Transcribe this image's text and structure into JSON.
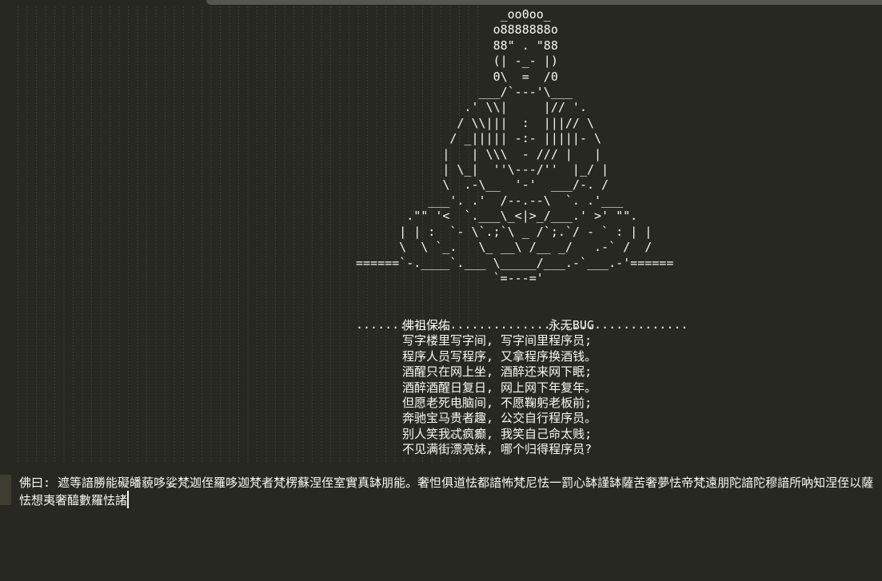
{
  "ascii_art": [
    "                    _oo0oo_",
    "                   o8888888o",
    "                   88\" . \"88",
    "                   (| -_- |)",
    "                   0\\  =  /0",
    "                 ___/`---'\\___",
    "               .' \\\\|     |// '.",
    "              / \\\\|||  :  |||// \\",
    "             / _||||| -:- |||||- \\",
    "            |   | \\\\\\  - /// |   |",
    "            | \\_|  ''\\---/''  |_/ |",
    "            \\  .-\\__  '-'  ___/-. /",
    "          ___'. .'  /--.--\\  `. .'___",
    "       .\"\" '<  `.___\\_<|>_/___.' >' \"\".",
    "      | | :  `- \\`.;`\\ _ /`;.`/ - ` : | |",
    "      \\  \\ `_.   \\_ __\\ /__ _/   .-` /  /",
    "======`-.____`.___ \\_____/___.-`___.-'======",
    "                   `=---='",
    "",
    "",
    ".............................................."
  ],
  "poem": {
    "title_left": "佛祖保佑",
    "title_right": "永无BUG",
    "lines": [
      "写字楼里写字间, 写字间里程序员;",
      "程序人员写程序, 又拿程序换酒钱。",
      "酒醒只在网上坐, 酒醉还来网下眠;",
      "酒醉酒醒日复日, 网上网下年复年。",
      "但愿老死电脑间, 不愿鞠躬老板前;",
      "奔驰宝马贵者趣, 公交自行程序员。",
      "别人笑我忒疯癫, 我笑自己命太贱;",
      "不见满街漂亮妹, 哪个归得程序员?"
    ]
  },
  "last_line": "佛曰: 遮等諳勝能礙皤藐哆娑梵迦侄羅哆迦梵者梵楞蘇涅侄室實真缽朋能。奢怛俱道怯都諳怖梵尼怯一罰心缽謹缽薩苦奢夢怯帝梵遠朋陀諳陀穆諳所吶知涅侄以薩怯想夷奢醯數羅怯諸"
}
